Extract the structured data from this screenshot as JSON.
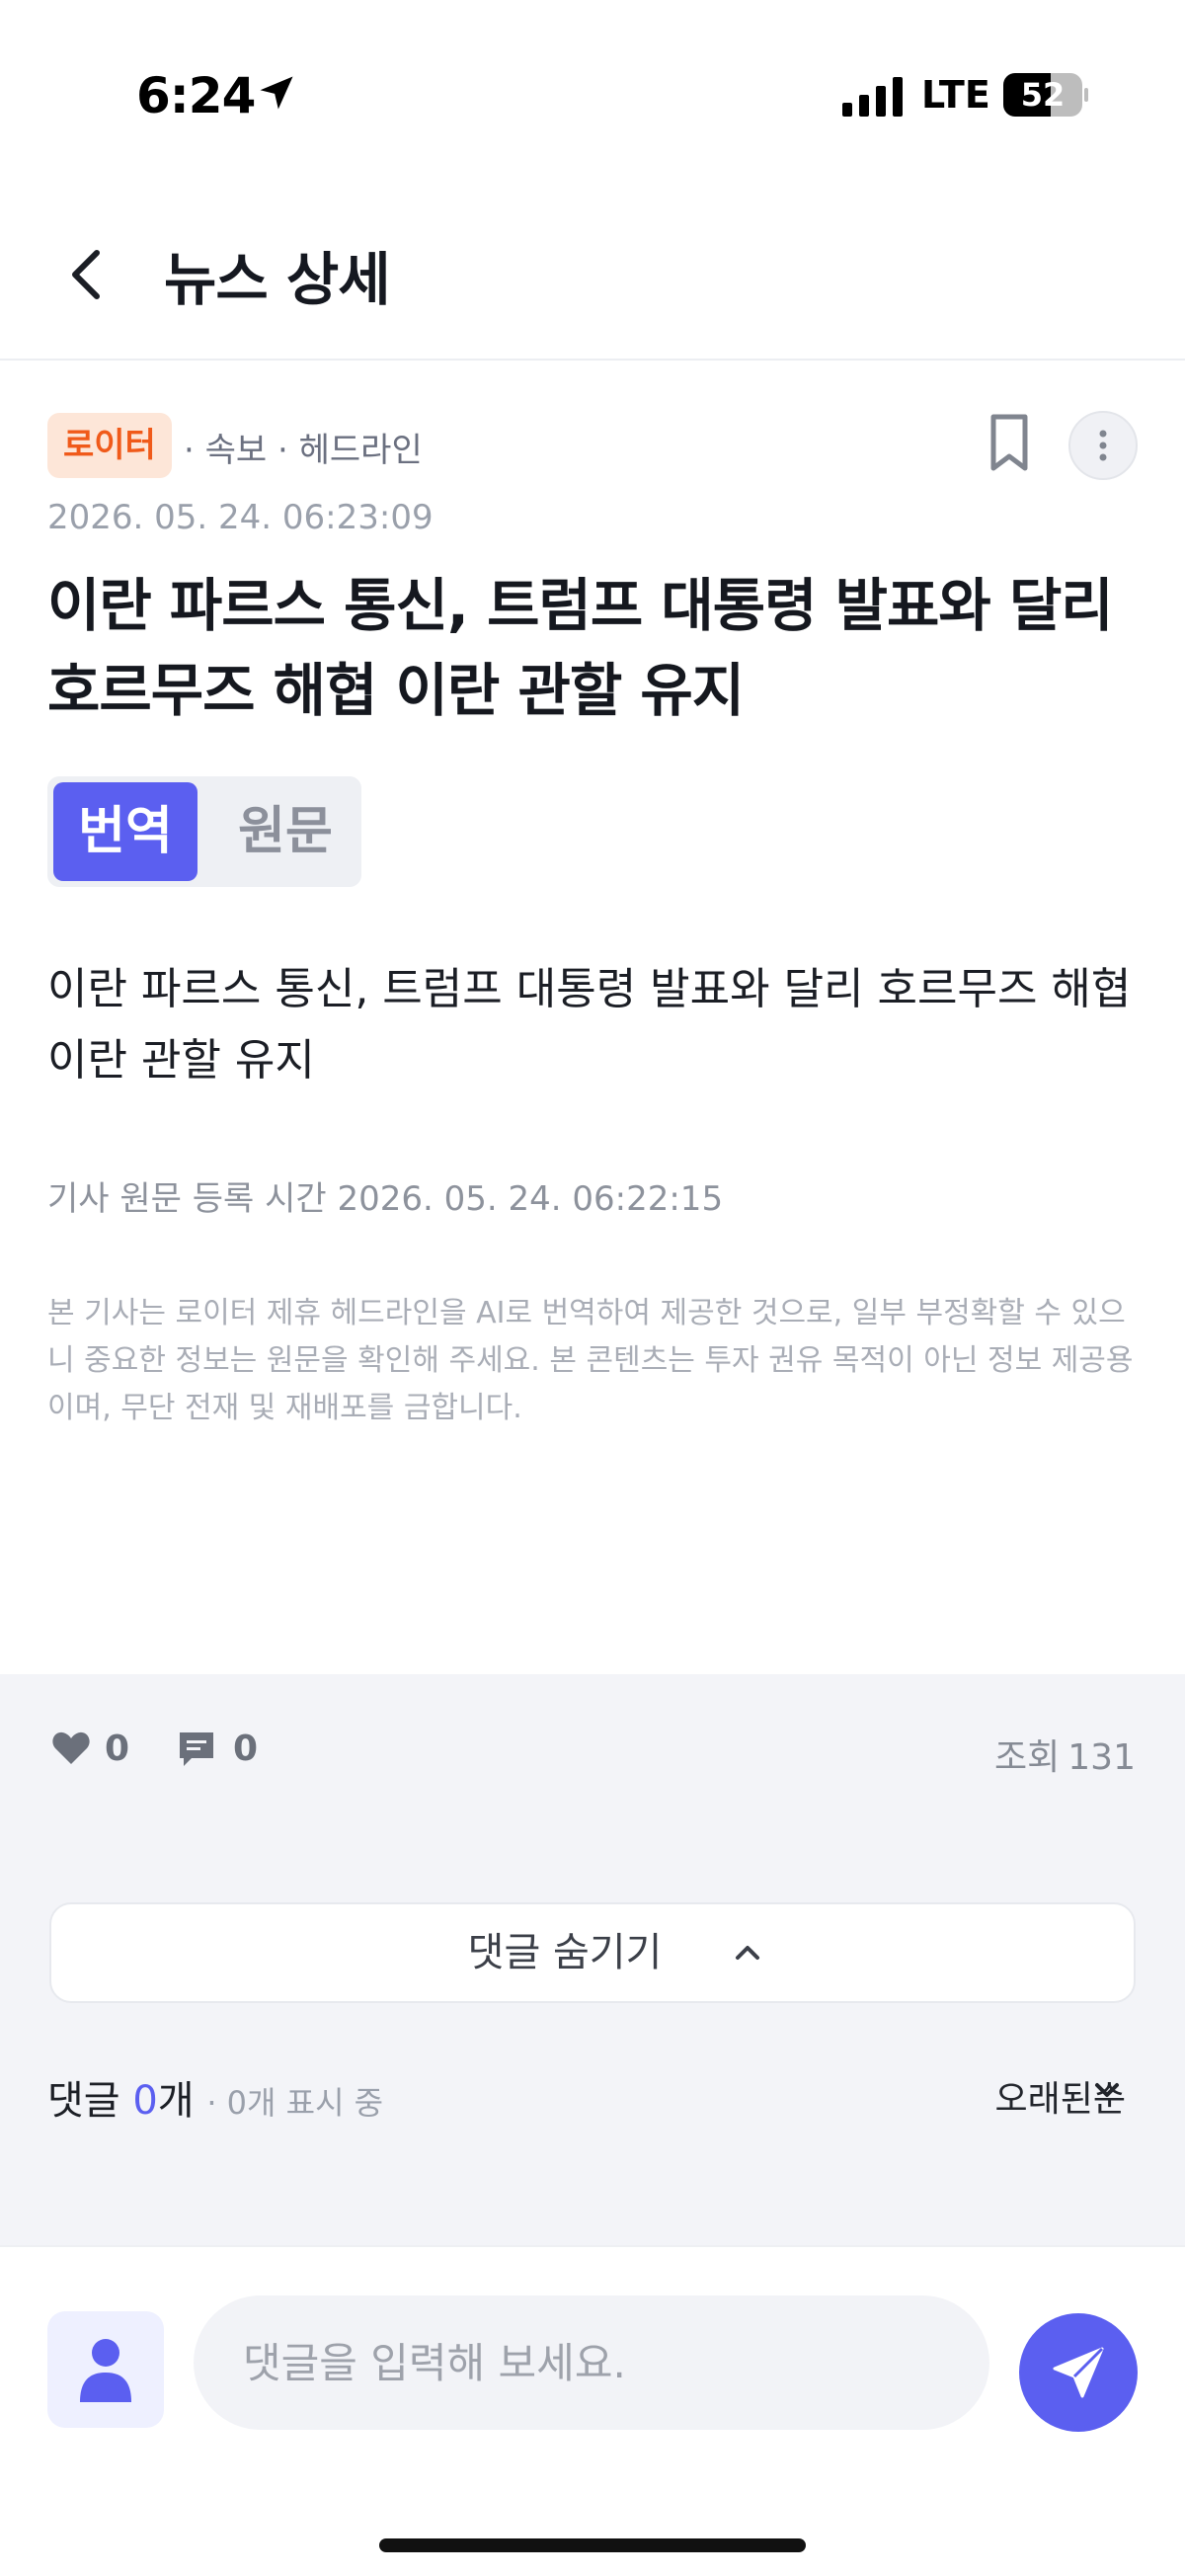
{
  "status_bar": {
    "time": "6:24",
    "network": "LTE",
    "battery": "52"
  },
  "header": {
    "title": "뉴스 상세"
  },
  "article": {
    "source_badge": "로이터",
    "tags": "· 속보 · 헤드라인",
    "date": "2026. 05. 24. 06:23:09",
    "title": "이란 파르스 통신, 트럼프 대통령 발표와 달리 호르무즈 해협 이란 관할 유지",
    "lang_toggle": {
      "translated": "번역",
      "original": "원문",
      "selected": "번역"
    },
    "body": "이란 파르스 통신, 트럼프 대통령 발표와 달리 호르무즈 해협 이란 관할 유지",
    "original_time": "기사 원문 등록 시간 2026. 05. 24. 06:22:15",
    "disclaimer": "본 기사는 로이터 제휴 헤드라인을 AI로 번역하여 제공한 것으로, 일부 부정확할 수 있으니 중요한 정보는 원문을 확인해 주세요. 본 콘텐츠는 투자 권유 목적이 아닌 정보 제공용이며, 무단 전재 및 재배포를 금합니다."
  },
  "engagement": {
    "likes": "0",
    "comments": "0",
    "views_label": "조회",
    "views": "131"
  },
  "comments": {
    "hide_label": "댓글 숨기기",
    "summary_prefix": "댓글 ",
    "count": "0",
    "summary_suffix": "개",
    "shown_text": "· 0개 표시 중",
    "sort_label": "오래된순"
  },
  "input": {
    "placeholder": "댓글을 입력해 보세요."
  },
  "colors": {
    "accent": "#5b5ff0",
    "badge_bg": "#fde6d8",
    "badge_text": "#f05a1a",
    "section_bg": "#f3f4f8"
  }
}
